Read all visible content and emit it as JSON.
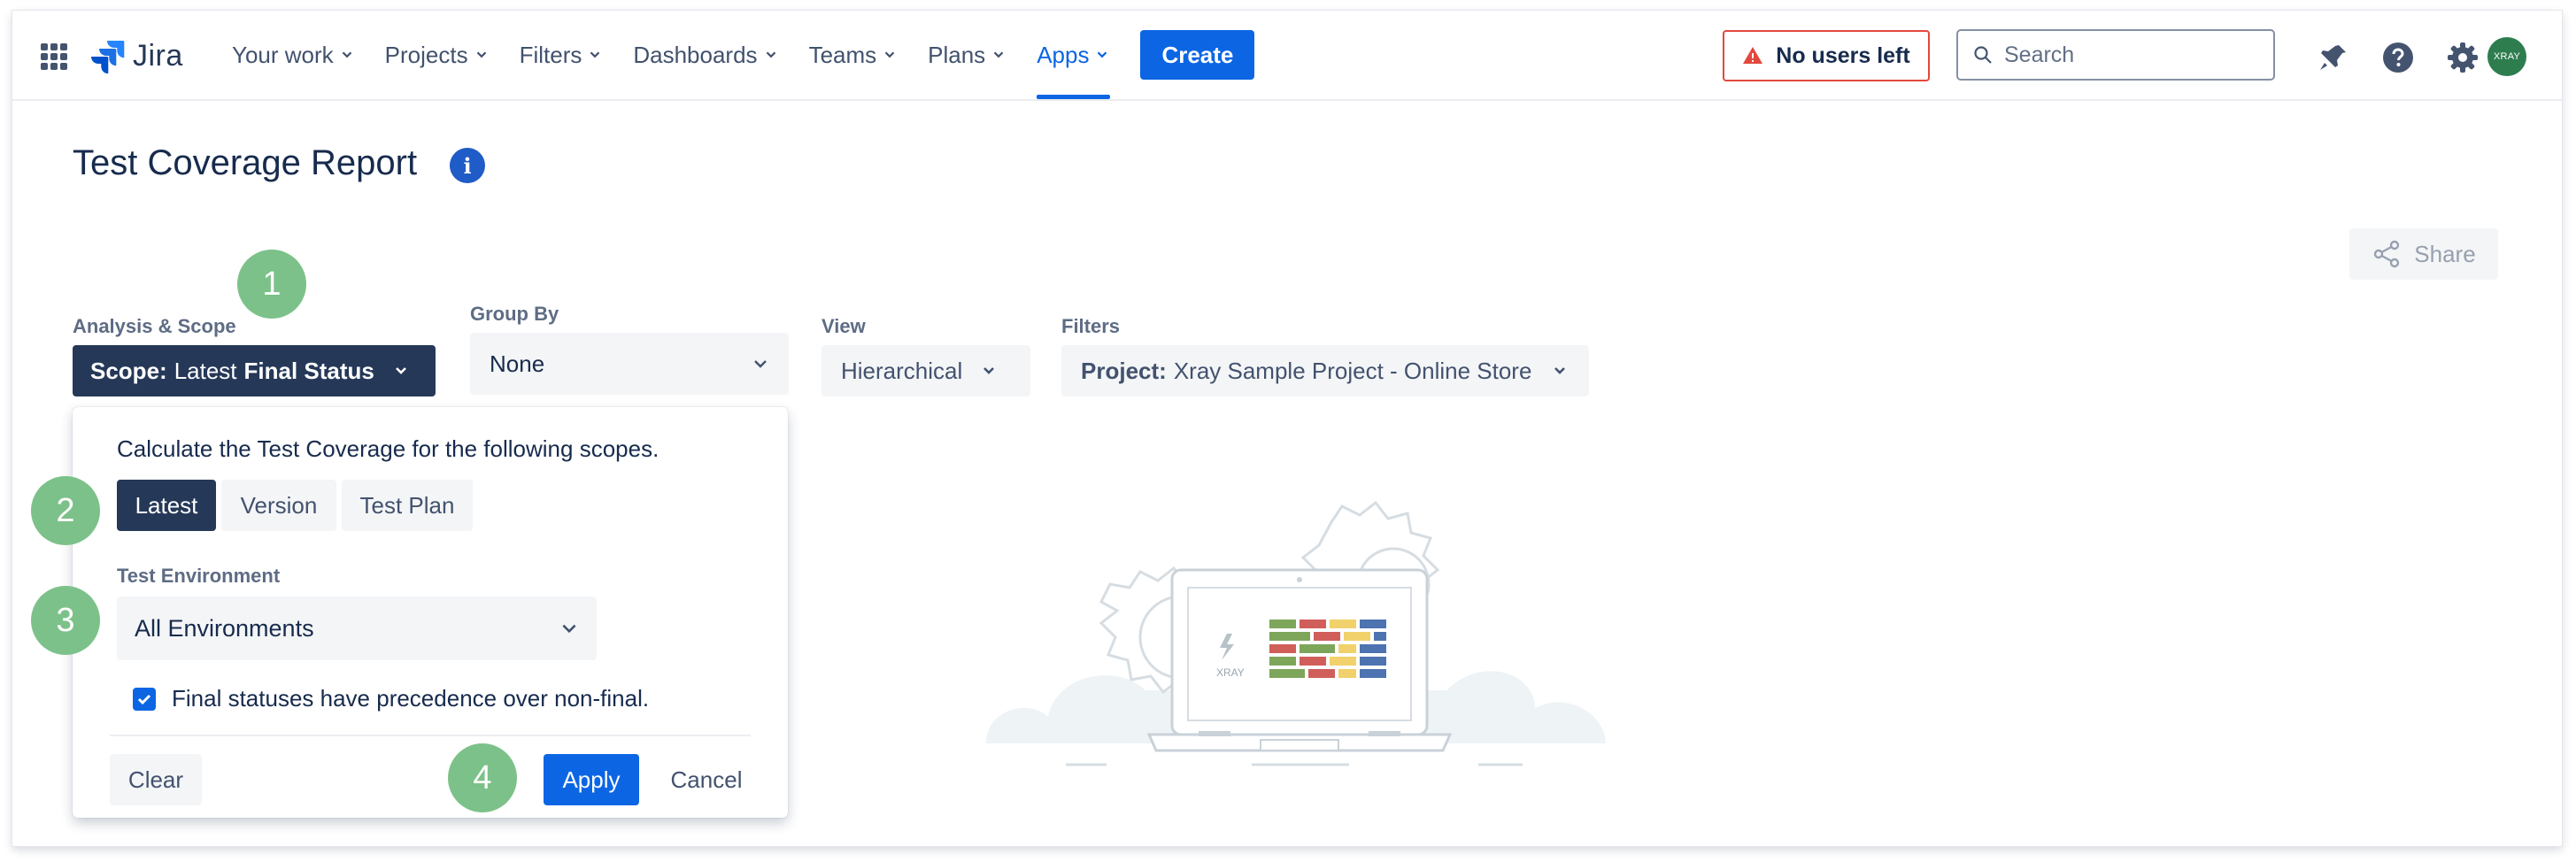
{
  "nav": {
    "logo": "Jira",
    "items": [
      {
        "label": "Your work"
      },
      {
        "label": "Projects"
      },
      {
        "label": "Filters"
      },
      {
        "label": "Dashboards"
      },
      {
        "label": "Teams"
      },
      {
        "label": "Plans"
      },
      {
        "label": "Apps",
        "active": true
      }
    ],
    "create_label": "Create",
    "no_users_label": "No users left",
    "search_placeholder": "Search",
    "avatar_label": "XRAY"
  },
  "page": {
    "title": "Test Coverage Report",
    "info_label": "i",
    "share_label": "Share"
  },
  "controls": {
    "analysis_label": "Analysis & Scope",
    "scope_prefix": "Scope:",
    "scope_mid": "Latest",
    "scope_value": "Final Status",
    "groupby_label": "Group By",
    "groupby_value": "None",
    "view_label": "View",
    "view_value": "Hierarchical",
    "filters_label": "Filters",
    "filter_prefix": "Project:",
    "filter_value": "Xray Sample Project - Online Store"
  },
  "popup": {
    "description": "Calculate the Test Coverage for the following scopes.",
    "scopes": [
      "Latest",
      "Version",
      "Test Plan"
    ],
    "selected_scope": "Latest",
    "env_label": "Test Environment",
    "env_value": "All Environments",
    "checkbox_label": "Final statuses have precedence over non-final.",
    "checkbox_checked": true,
    "clear_label": "Clear",
    "apply_label": "Apply",
    "cancel_label": "Cancel"
  },
  "badges": [
    "1",
    "2",
    "3",
    "4"
  ],
  "illustration": {
    "brand_text": "XRAY"
  },
  "colors": {
    "primary": "#0c66e4",
    "scope_dark": "#253858",
    "badge_green": "#7cc189",
    "warning_red": "#e2483d"
  }
}
